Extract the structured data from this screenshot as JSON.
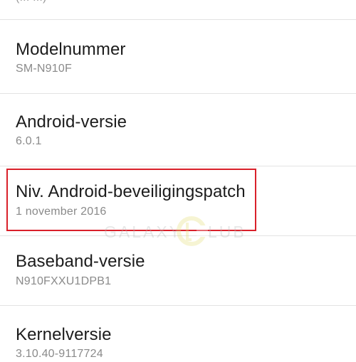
{
  "partial_row": {
    "text": "(... ...)"
  },
  "rows": [
    {
      "title": "Modelnummer",
      "value": "SM-N910F"
    },
    {
      "title": "Android-versie",
      "value": "6.0.1"
    },
    {
      "title": "Niv. Android-beveiligingspatch",
      "value": "1 november 2016"
    },
    {
      "title": "Baseband-versie",
      "value": "N910FXXU1DPB1"
    },
    {
      "title": "Kernelversie",
      "value": "3.10.40-9117724"
    }
  ],
  "watermark": {
    "left": "GALAXY",
    "right": "LUB",
    "icon": "galaxyclub-c-logo"
  },
  "colors": {
    "highlight": "#d9202a",
    "divider": "#e3e3e3",
    "title": "#1c1c1c",
    "subtitle": "#8a8a8a",
    "watermark_accent": "#e6e07a"
  }
}
